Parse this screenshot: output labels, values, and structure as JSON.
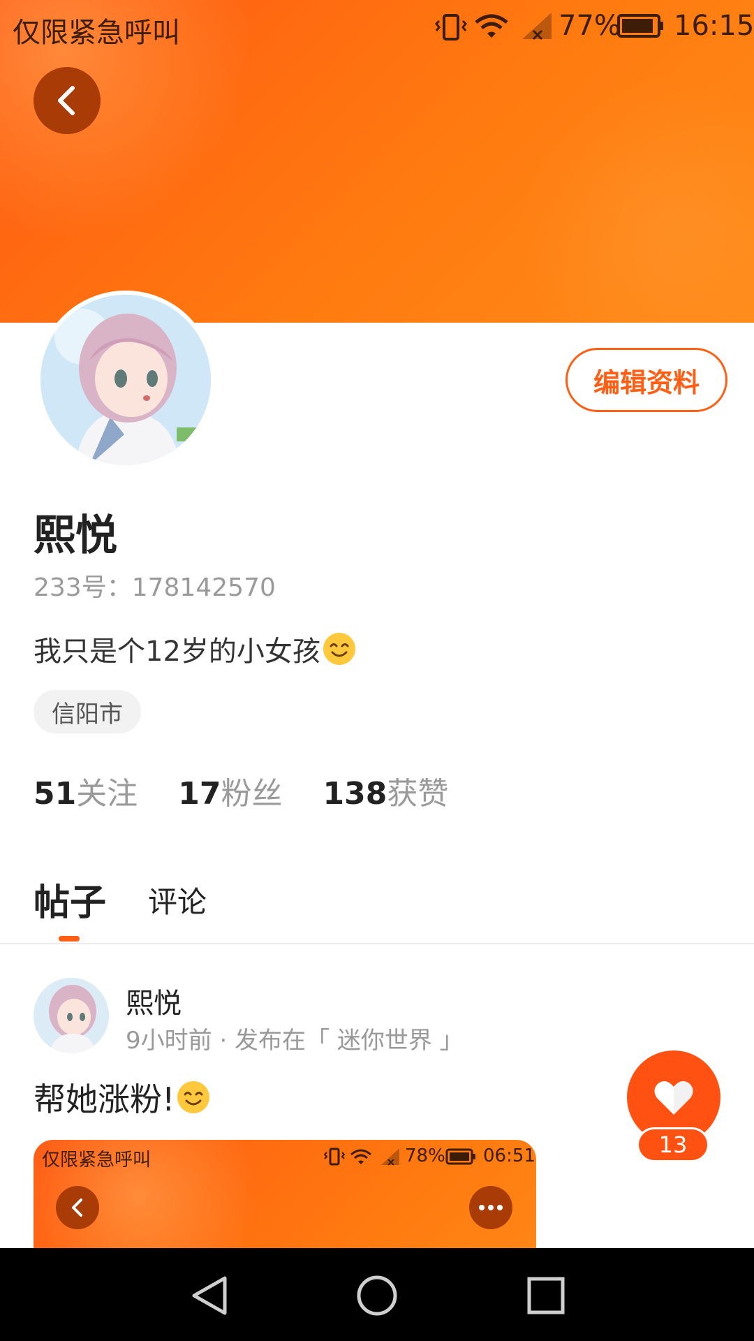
{
  "status_bar": {
    "carrier": "仅限紧急呼叫",
    "battery": "77%",
    "time": "16:15"
  },
  "profile": {
    "name": "熙悦",
    "id_label": "233号：",
    "id_value": "178142570",
    "bio": "我只是个12岁的小女孩",
    "location": "信阳市",
    "edit_button": "编辑资料"
  },
  "stats": {
    "following_count": "51",
    "following_label": "关注",
    "fans_count": "17",
    "fans_label": "粉丝",
    "likes_count": "138",
    "likes_label": "获赞"
  },
  "tabs": {
    "posts": "帖子",
    "comments": "评论",
    "active": "posts"
  },
  "post": {
    "author": "熙悦",
    "meta": "9小时前 · 发布在「 迷你世界 」",
    "text": "帮她涨粉!",
    "like_count": "13",
    "image": {
      "carrier": "仅限紧急呼叫",
      "battery": "78%",
      "time": "06:51"
    }
  },
  "colors": {
    "accent": "#ff5f14",
    "header_start": "#ff5a12",
    "header_end": "#ff8b18"
  },
  "icons": [
    "back-arrow-icon",
    "vibrate-icon",
    "wifi-icon",
    "signal-icon",
    "battery-icon",
    "smile-emoji-icon",
    "heart-icon",
    "more-icon",
    "nav-back-icon",
    "nav-home-icon",
    "nav-recents-icon"
  ]
}
